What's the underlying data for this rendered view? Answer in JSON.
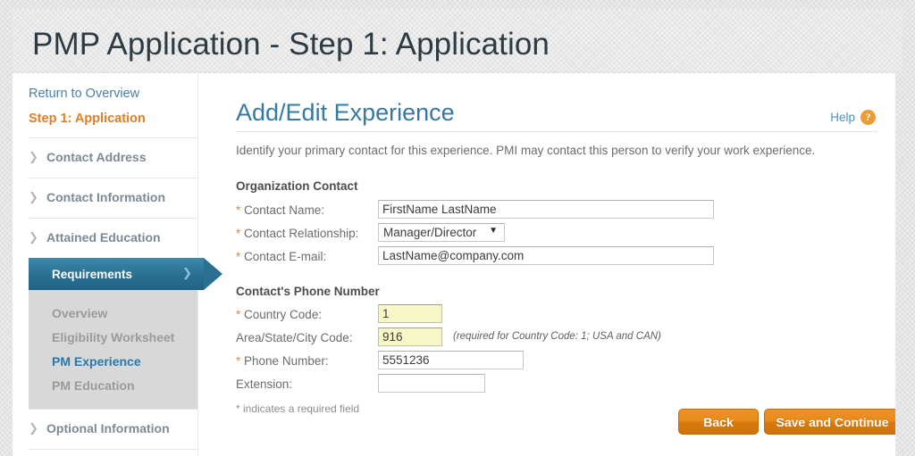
{
  "header": {
    "title": "PMP Application - Step 1: Application"
  },
  "sidebar": {
    "return_link": "Return to Overview",
    "current_step": "Step 1: Application",
    "groups": [
      {
        "label": "Contact Address",
        "icon": "chevron-right-icon"
      },
      {
        "label": "Contact Information",
        "icon": "chevron-right-icon"
      },
      {
        "label": "Attained Education",
        "icon": "chevron-right-icon"
      }
    ],
    "active_group": {
      "label": "Requirements",
      "icon": "chevron-right-icon"
    },
    "sub_items": [
      {
        "label": "Overview",
        "active": false
      },
      {
        "label": "Eligibility Worksheet",
        "active": false
      },
      {
        "label": "PM Experience",
        "active": true
      },
      {
        "label": "PM Education",
        "active": false
      }
    ],
    "trailing_groups": [
      {
        "label": "Optional Information",
        "icon": "chevron-right-icon"
      }
    ]
  },
  "content": {
    "title": "Add/Edit Experience",
    "help_label": "Help",
    "help_icon": "question-mark-circle-icon",
    "intro": "Identify your primary contact for this experience. PMI may contact this person to verify your work experience.",
    "organization_section": {
      "title": "Organization Contact",
      "fields": [
        {
          "label": "Contact Name:",
          "required": true,
          "value": "FirstName LastName",
          "type": "text"
        },
        {
          "label": "Contact Relationship:",
          "required": true,
          "value": "Manager/Director",
          "type": "select"
        },
        {
          "label": "Contact E-mail:",
          "required": true,
          "value": "LastName@company.com",
          "type": "text"
        }
      ]
    },
    "phone_section": {
      "title": "Contact's Phone Number",
      "fields": [
        {
          "label": "Country Code:",
          "required": true,
          "value": "1",
          "type": "text",
          "highlight": true
        },
        {
          "label": "Area/State/City Code:",
          "required": false,
          "value": "916",
          "type": "text",
          "highlight": true,
          "hint": "(required for Country Code: 1; USA and CAN)"
        },
        {
          "label": "Phone Number:",
          "required": true,
          "value": "5551236",
          "type": "text",
          "highlight": false
        },
        {
          "label": "Extension:",
          "required": false,
          "value": "",
          "type": "text",
          "highlight": false
        }
      ]
    },
    "required_note": "* indicates a required field",
    "buttons": {
      "back": "Back",
      "save_continue": "Save and Continue"
    }
  },
  "colors": {
    "accent_blue": "#3579a4",
    "accent_orange": "#e57d22",
    "button_orange": "#e68b1c",
    "active_nav_blue": "#2d7394",
    "highlight_yellow": "#f7f7c7"
  }
}
